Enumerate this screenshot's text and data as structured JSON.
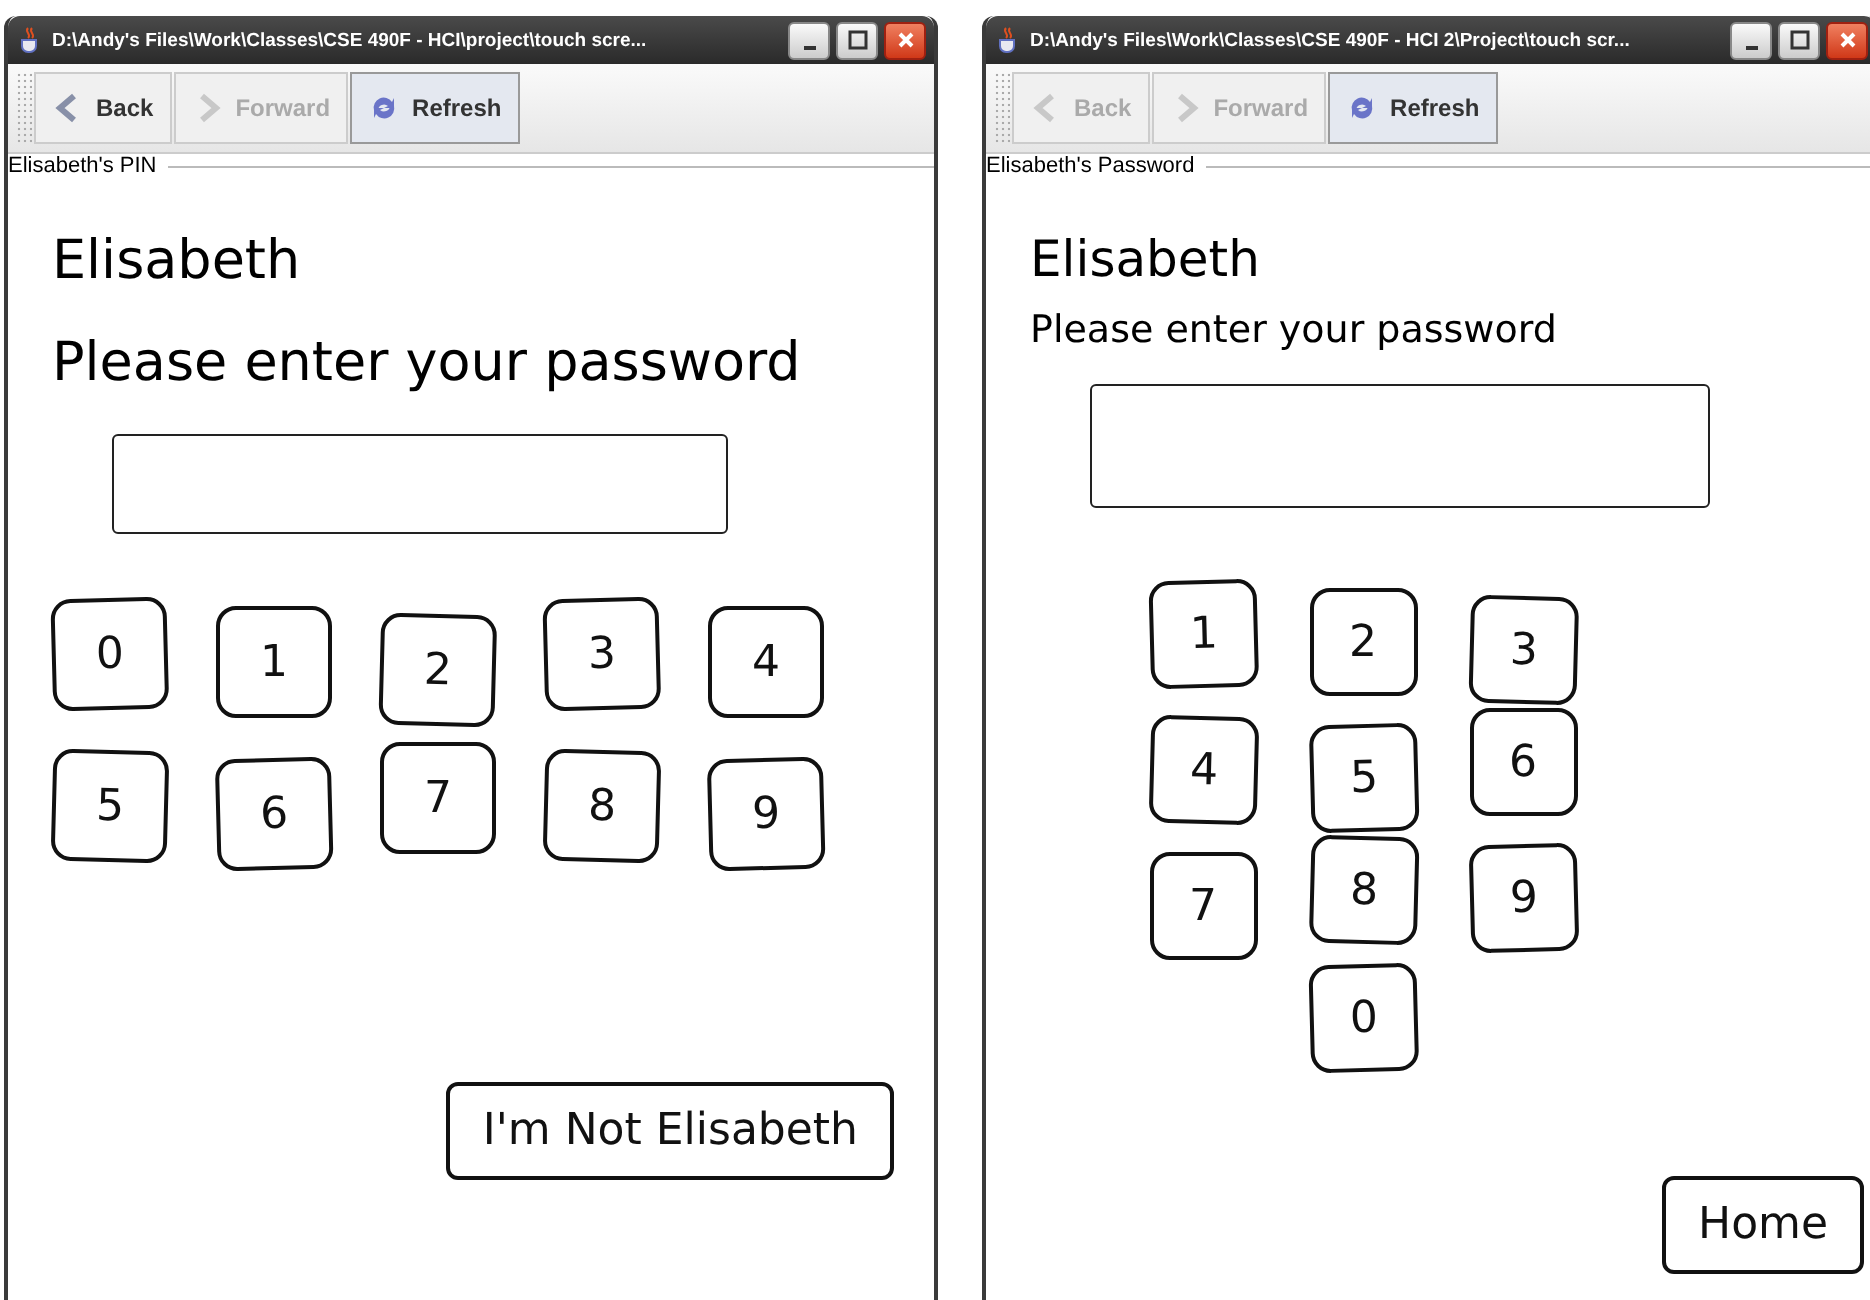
{
  "windows": [
    {
      "kind": "large",
      "title": "D:\\Andy's Files\\Work\\Classes\\CSE 490F - HCI\\project\\touch scre...",
      "toolbar": [
        {
          "label": "Back",
          "disabled": false
        },
        {
          "label": "Forward",
          "disabled": true
        },
        {
          "label": "Refresh",
          "disabled": false
        }
      ],
      "panel_title": "Elisabeth's PIN",
      "name": "Elisabeth",
      "prompt": "Please enter your password",
      "key_rows": [
        [
          "0",
          "1",
          "2",
          "3",
          "4"
        ],
        [
          "5",
          "6",
          "7",
          "8",
          "9"
        ]
      ],
      "action_button": "I'm Not Elisabeth"
    },
    {
      "kind": "compact",
      "title": "D:\\Andy's Files\\Work\\Classes\\CSE 490F - HCI 2\\Project\\touch scr...",
      "toolbar": [
        {
          "label": "Back",
          "disabled": true
        },
        {
          "label": "Forward",
          "disabled": true
        },
        {
          "label": "Refresh",
          "disabled": false
        }
      ],
      "panel_title": "Elisabeth's Password",
      "name": "Elisabeth",
      "prompt": "Please enter your password",
      "key_rows": [
        [
          "1",
          "2",
          "3"
        ],
        [
          "4",
          "5",
          "6"
        ],
        [
          "7",
          "8",
          "9"
        ],
        [
          "0"
        ]
      ],
      "action_button": "Home"
    }
  ]
}
